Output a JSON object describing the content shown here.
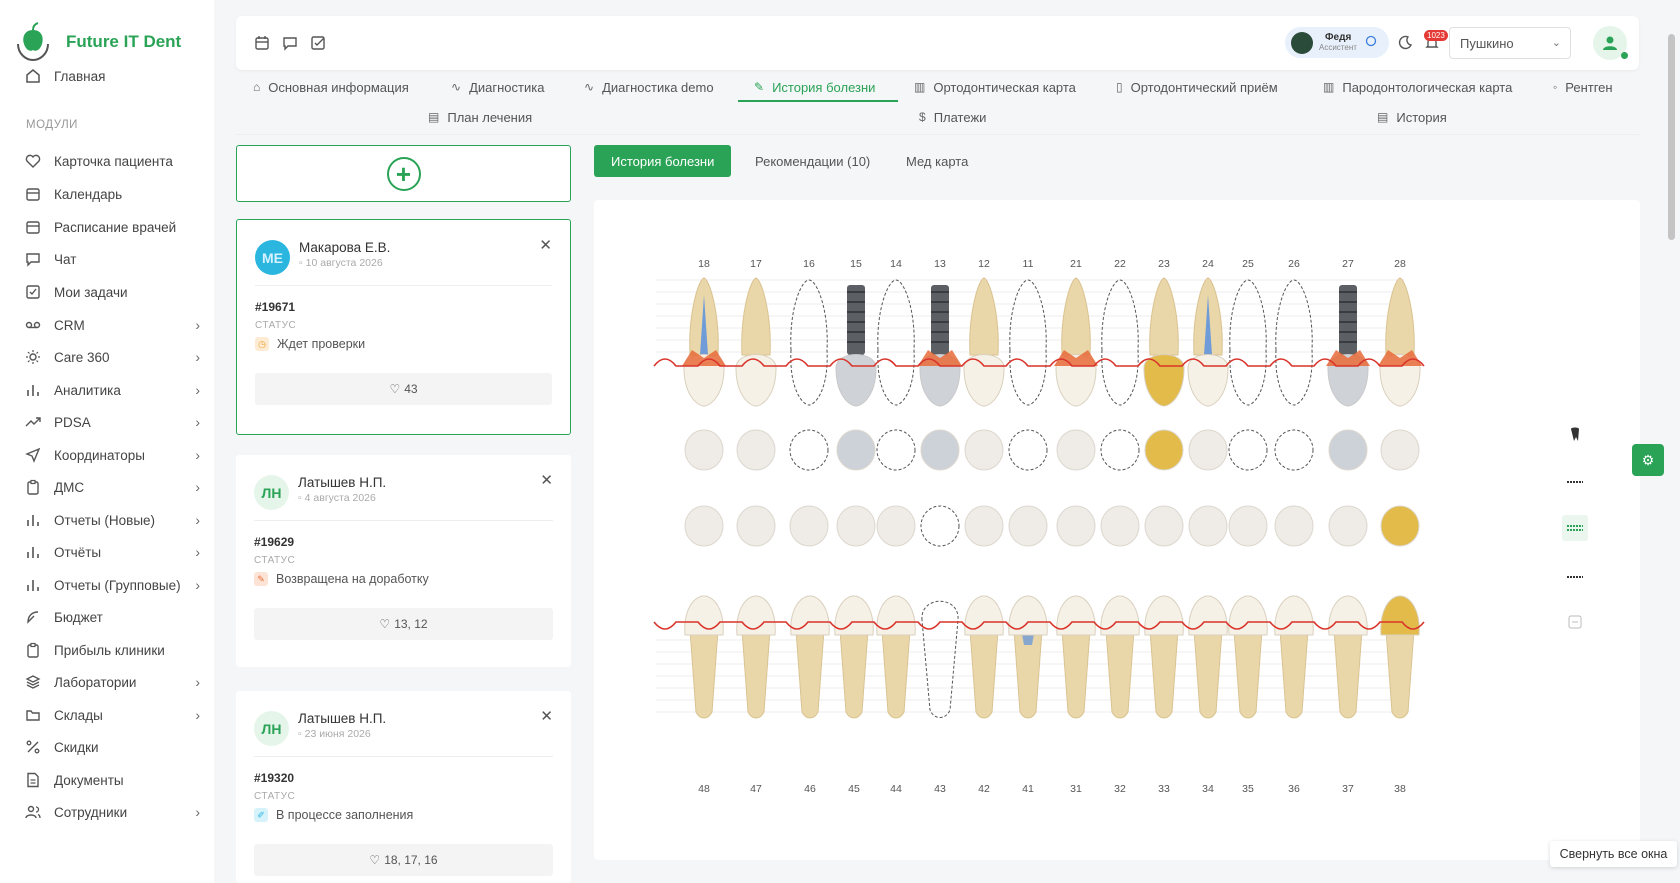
{
  "app": {
    "name": "Future IT Dent"
  },
  "sidebar": {
    "home": "Главная",
    "section": "МОДУЛИ",
    "items": [
      {
        "label": "Карточка пациента",
        "icon": "heart-icon",
        "chev": false
      },
      {
        "label": "Календарь",
        "icon": "calendar-icon",
        "chev": false
      },
      {
        "label": "Расписание врачей",
        "icon": "calendar-icon",
        "chev": false
      },
      {
        "label": "Чат",
        "icon": "chat-icon",
        "chev": false
      },
      {
        "label": "Мои задачи",
        "icon": "checkbox-icon",
        "chev": false
      },
      {
        "label": "CRM",
        "icon": "voicemail-icon",
        "chev": true
      },
      {
        "label": "Care 360",
        "icon": "sun-icon",
        "chev": true
      },
      {
        "label": "Аналитика",
        "icon": "bar-chart-icon",
        "chev": true
      },
      {
        "label": "PDSA",
        "icon": "trend-icon",
        "chev": true
      },
      {
        "label": "Координаторы",
        "icon": "send-icon",
        "chev": true
      },
      {
        "label": "ДМС",
        "icon": "clipboard-icon",
        "chev": true
      },
      {
        "label": "Отчеты (Новые)",
        "icon": "bar-chart-icon",
        "chev": true
      },
      {
        "label": "Отчёты",
        "icon": "bar-chart-icon",
        "chev": true
      },
      {
        "label": "Отчеты (Групповые)",
        "icon": "bar-chart-icon",
        "chev": true
      },
      {
        "label": "Бюджет",
        "icon": "feather-icon",
        "chev": false
      },
      {
        "label": "Прибыль клиники",
        "icon": "clipboard-icon",
        "chev": false
      },
      {
        "label": "Лаборатории",
        "icon": "layers-icon",
        "chev": true
      },
      {
        "label": "Склады",
        "icon": "folder-icon",
        "chev": true
      },
      {
        "label": "Скидки",
        "icon": "percent-icon",
        "chev": false
      },
      {
        "label": "Документы",
        "icon": "document-icon",
        "chev": false
      },
      {
        "label": "Сотрудники",
        "icon": "users-icon",
        "chev": true
      }
    ]
  },
  "topbar": {
    "assistant_name": "Федя",
    "assistant_role": "Ассистент",
    "notifications": "1023",
    "branch": "Пушкино"
  },
  "tabs": [
    "Основная информация",
    "Диагностика",
    "Диагностика demo",
    "История болезни",
    "Ортодонтическая карта",
    "Ортодонтический приём",
    "Пародонтологическая карта",
    "Рентген",
    "План лечения",
    "Платежи",
    "История"
  ],
  "records": [
    {
      "initials": "МЕ",
      "name": "Макарова Е.В.",
      "date": "10 августа 2026",
      "number": "#19671",
      "status_label": "СТАТУС",
      "status": "Ждет проверки",
      "teeth": "43"
    },
    {
      "initials": "ЛН",
      "name": "Латышев Н.П.",
      "date": "4 августа 2026",
      "number": "#19629",
      "status_label": "СТАТУС",
      "status": "Возвращена на доработку",
      "teeth": "13, 12"
    },
    {
      "initials": "ЛН",
      "name": "Латышев Н.П.",
      "date": "23 июня 2026",
      "number": "#19320",
      "status_label": "СТАТУС",
      "status": "В процессе заполнения",
      "teeth": "18, 17, 16"
    }
  ],
  "subtabs": [
    "История болезни",
    "Рекомендации (10)",
    "Мед карта"
  ],
  "dental_chart": {
    "upper": [
      "18",
      "17",
      "16",
      "15",
      "14",
      "13",
      "12",
      "11",
      "21",
      "22",
      "23",
      "24",
      "25",
      "26",
      "27",
      "28"
    ],
    "lower": [
      "48",
      "47",
      "46",
      "45",
      "44",
      "43",
      "42",
      "41",
      "31",
      "32",
      "33",
      "34",
      "35",
      "36",
      "37",
      "38"
    ]
  },
  "collapse_button": "Свернуть все окна",
  "colors": {
    "accent": "#2aa356",
    "gum_line": "#d9342b",
    "root_canal": "#6f9bd8",
    "gold": "#e2bb4a",
    "gum": "#e86b3a"
  }
}
